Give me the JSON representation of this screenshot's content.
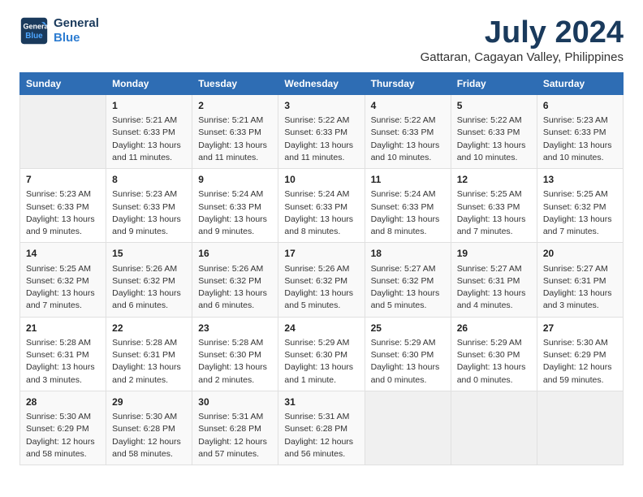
{
  "logo": {
    "line1": "General",
    "line2": "Blue"
  },
  "title": "July 2024",
  "subtitle": "Gattaran, Cagayan Valley, Philippines",
  "days_header": [
    "Sunday",
    "Monday",
    "Tuesday",
    "Wednesday",
    "Thursday",
    "Friday",
    "Saturday"
  ],
  "weeks": [
    [
      {
        "num": "",
        "content": ""
      },
      {
        "num": "1",
        "content": "Sunrise: 5:21 AM\nSunset: 6:33 PM\nDaylight: 13 hours\nand 11 minutes."
      },
      {
        "num": "2",
        "content": "Sunrise: 5:21 AM\nSunset: 6:33 PM\nDaylight: 13 hours\nand 11 minutes."
      },
      {
        "num": "3",
        "content": "Sunrise: 5:22 AM\nSunset: 6:33 PM\nDaylight: 13 hours\nand 11 minutes."
      },
      {
        "num": "4",
        "content": "Sunrise: 5:22 AM\nSunset: 6:33 PM\nDaylight: 13 hours\nand 10 minutes."
      },
      {
        "num": "5",
        "content": "Sunrise: 5:22 AM\nSunset: 6:33 PM\nDaylight: 13 hours\nand 10 minutes."
      },
      {
        "num": "6",
        "content": "Sunrise: 5:23 AM\nSunset: 6:33 PM\nDaylight: 13 hours\nand 10 minutes."
      }
    ],
    [
      {
        "num": "7",
        "content": "Sunrise: 5:23 AM\nSunset: 6:33 PM\nDaylight: 13 hours\nand 9 minutes."
      },
      {
        "num": "8",
        "content": "Sunrise: 5:23 AM\nSunset: 6:33 PM\nDaylight: 13 hours\nand 9 minutes."
      },
      {
        "num": "9",
        "content": "Sunrise: 5:24 AM\nSunset: 6:33 PM\nDaylight: 13 hours\nand 9 minutes."
      },
      {
        "num": "10",
        "content": "Sunrise: 5:24 AM\nSunset: 6:33 PM\nDaylight: 13 hours\nand 8 minutes."
      },
      {
        "num": "11",
        "content": "Sunrise: 5:24 AM\nSunset: 6:33 PM\nDaylight: 13 hours\nand 8 minutes."
      },
      {
        "num": "12",
        "content": "Sunrise: 5:25 AM\nSunset: 6:33 PM\nDaylight: 13 hours\nand 7 minutes."
      },
      {
        "num": "13",
        "content": "Sunrise: 5:25 AM\nSunset: 6:32 PM\nDaylight: 13 hours\nand 7 minutes."
      }
    ],
    [
      {
        "num": "14",
        "content": "Sunrise: 5:25 AM\nSunset: 6:32 PM\nDaylight: 13 hours\nand 7 minutes."
      },
      {
        "num": "15",
        "content": "Sunrise: 5:26 AM\nSunset: 6:32 PM\nDaylight: 13 hours\nand 6 minutes."
      },
      {
        "num": "16",
        "content": "Sunrise: 5:26 AM\nSunset: 6:32 PM\nDaylight: 13 hours\nand 6 minutes."
      },
      {
        "num": "17",
        "content": "Sunrise: 5:26 AM\nSunset: 6:32 PM\nDaylight: 13 hours\nand 5 minutes."
      },
      {
        "num": "18",
        "content": "Sunrise: 5:27 AM\nSunset: 6:32 PM\nDaylight: 13 hours\nand 5 minutes."
      },
      {
        "num": "19",
        "content": "Sunrise: 5:27 AM\nSunset: 6:31 PM\nDaylight: 13 hours\nand 4 minutes."
      },
      {
        "num": "20",
        "content": "Sunrise: 5:27 AM\nSunset: 6:31 PM\nDaylight: 13 hours\nand 3 minutes."
      }
    ],
    [
      {
        "num": "21",
        "content": "Sunrise: 5:28 AM\nSunset: 6:31 PM\nDaylight: 13 hours\nand 3 minutes."
      },
      {
        "num": "22",
        "content": "Sunrise: 5:28 AM\nSunset: 6:31 PM\nDaylight: 13 hours\nand 2 minutes."
      },
      {
        "num": "23",
        "content": "Sunrise: 5:28 AM\nSunset: 6:30 PM\nDaylight: 13 hours\nand 2 minutes."
      },
      {
        "num": "24",
        "content": "Sunrise: 5:29 AM\nSunset: 6:30 PM\nDaylight: 13 hours\nand 1 minute."
      },
      {
        "num": "25",
        "content": "Sunrise: 5:29 AM\nSunset: 6:30 PM\nDaylight: 13 hours\nand 0 minutes."
      },
      {
        "num": "26",
        "content": "Sunrise: 5:29 AM\nSunset: 6:30 PM\nDaylight: 13 hours\nand 0 minutes."
      },
      {
        "num": "27",
        "content": "Sunrise: 5:30 AM\nSunset: 6:29 PM\nDaylight: 12 hours\nand 59 minutes."
      }
    ],
    [
      {
        "num": "28",
        "content": "Sunrise: 5:30 AM\nSunset: 6:29 PM\nDaylight: 12 hours\nand 58 minutes."
      },
      {
        "num": "29",
        "content": "Sunrise: 5:30 AM\nSunset: 6:28 PM\nDaylight: 12 hours\nand 58 minutes."
      },
      {
        "num": "30",
        "content": "Sunrise: 5:31 AM\nSunset: 6:28 PM\nDaylight: 12 hours\nand 57 minutes."
      },
      {
        "num": "31",
        "content": "Sunrise: 5:31 AM\nSunset: 6:28 PM\nDaylight: 12 hours\nand 56 minutes."
      },
      {
        "num": "",
        "content": ""
      },
      {
        "num": "",
        "content": ""
      },
      {
        "num": "",
        "content": ""
      }
    ]
  ]
}
